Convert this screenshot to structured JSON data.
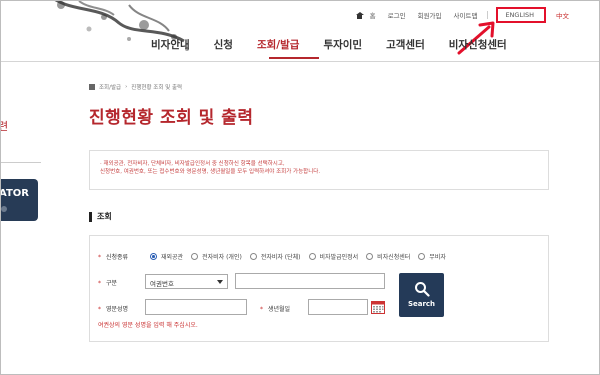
{
  "header": {
    "utility": {
      "home": "홈",
      "login": "로그인",
      "join": "회원가입",
      "sitemap": "사이트맵",
      "english": "ENGLISH",
      "chinese": "中文"
    },
    "gnb": [
      "비자안내",
      "신청",
      "조회/발급",
      "투자이민",
      "고객센터",
      "비자신청센터"
    ],
    "active_index": 2
  },
  "sidebar": {
    "partial_text": "련",
    "simulator_label": "ATOR"
  },
  "breadcrumb": [
    "조회/발급",
    "진행현황 조회 및 출력"
  ],
  "page_title": "진행현황 조회 및 출력",
  "notice": [
    "· 재외공관, 전자비자, 단체비자, 비자발급인정서 중 신청하신 항목을 선택하시고,",
    "  신청번호, 여권번호, 또는 접수번호와 영문성명, 생년월일을 모두 입력하셔야 조회가 가능합니다."
  ],
  "section_title": "조회",
  "form": {
    "type_label": "신청종류",
    "type_options": [
      "재외공관",
      "전자비자 (개인)",
      "전자비자 (단체)",
      "비자발급인정서",
      "비자신청센터",
      "무비자"
    ],
    "selected_type": 0,
    "category_label": "구분",
    "category_value": "여권번호",
    "name_label": "영문성명",
    "dob_label": "생년월일",
    "search_label": "Search",
    "hint": "여권상의 영문 성명을 입력 해 주십시오."
  },
  "colors": {
    "accent": "#b5272d",
    "navy": "#243a58",
    "highlight_box": "#e3102b"
  }
}
